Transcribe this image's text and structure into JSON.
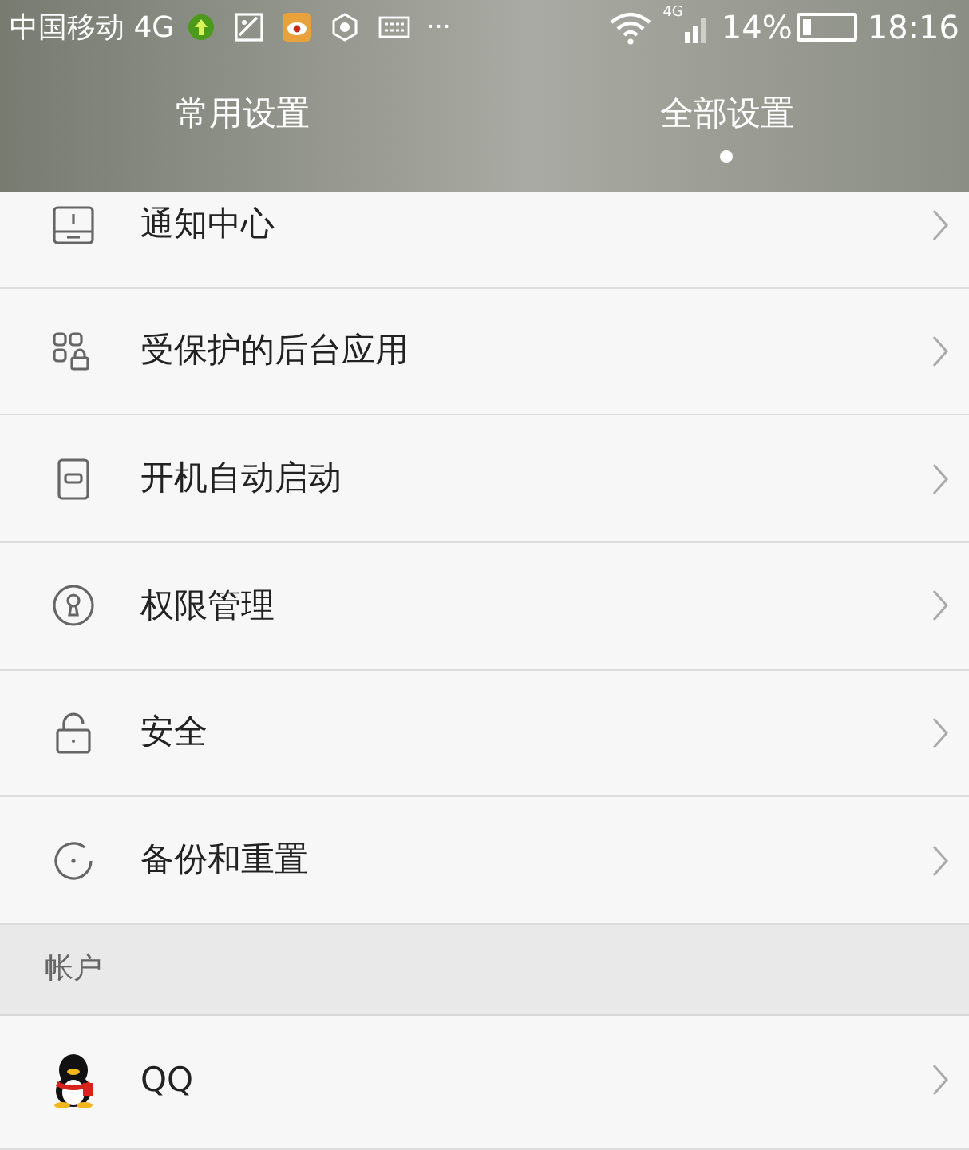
{
  "status_bar": {
    "carrier": "中国移动 4G",
    "more": "···",
    "network": "4G",
    "battery": "14%",
    "time": "18:16"
  },
  "tabs": [
    {
      "label": "常用设置",
      "selected": false
    },
    {
      "label": "全部设置",
      "selected": true
    }
  ],
  "items": [
    {
      "kind": "notice",
      "label": "通知中心"
    },
    {
      "kind": "apps",
      "label": "受保护的后台应用"
    },
    {
      "kind": "startup",
      "label": "开机自动启动"
    },
    {
      "kind": "permission",
      "label": "权限管理"
    },
    {
      "kind": "security",
      "label": "安全"
    },
    {
      "kind": "backup",
      "label": "备份和重置"
    }
  ],
  "section": {
    "title": "帐户",
    "items": [
      {
        "kind": "qq",
        "label": "QQ"
      }
    ]
  }
}
